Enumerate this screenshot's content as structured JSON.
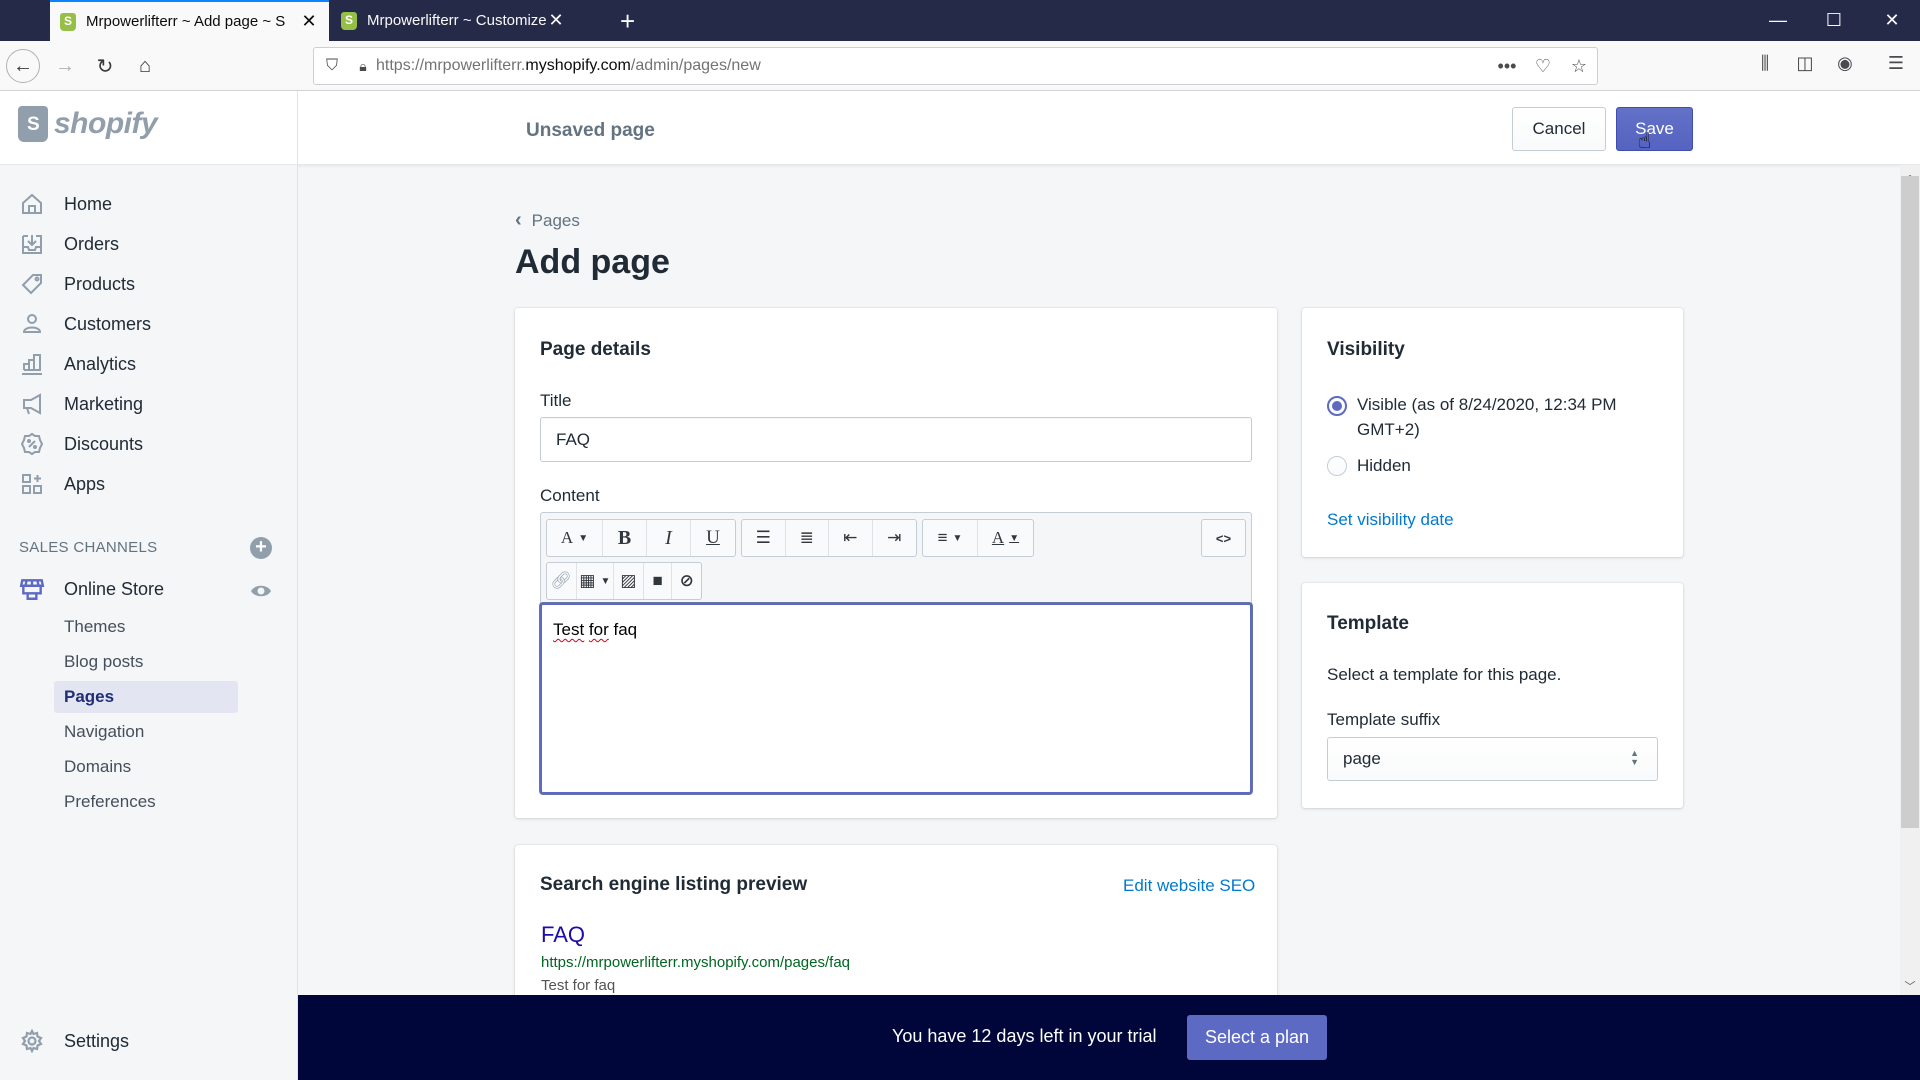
{
  "browser": {
    "tabs": [
      {
        "title": "Mrpowerlifterr ~ Add page ~ S",
        "active": true
      },
      {
        "title": "Mrpowerlifterr ~ Customize ~ I",
        "active": false
      }
    ],
    "new_tab": "+",
    "url_prefix": "https://mrpowerlifterr.",
    "url_domain": "myshopify.com",
    "url_path": "/admin/pages/new",
    "window_controls": {
      "minimize": "—",
      "maximize": "☐",
      "close": "✕"
    }
  },
  "topbar": {
    "logo": "shopify",
    "page_status": "Unsaved page",
    "cancel_label": "Cancel",
    "save_label": "Save"
  },
  "sidebar": {
    "items": [
      {
        "label": "Home",
        "icon": "home-icon"
      },
      {
        "label": "Orders",
        "icon": "orders-icon"
      },
      {
        "label": "Products",
        "icon": "tag-icon"
      },
      {
        "label": "Customers",
        "icon": "person-icon"
      },
      {
        "label": "Analytics",
        "icon": "bar-chart-icon"
      },
      {
        "label": "Marketing",
        "icon": "megaphone-icon"
      },
      {
        "label": "Discounts",
        "icon": "discount-icon"
      },
      {
        "label": "Apps",
        "icon": "apps-icon"
      }
    ],
    "sales_channels_heading": "SALES CHANNELS",
    "online_store": "Online Store",
    "sub_items": [
      {
        "label": "Themes",
        "active": false
      },
      {
        "label": "Blog posts",
        "active": false
      },
      {
        "label": "Pages",
        "active": true
      },
      {
        "label": "Navigation",
        "active": false
      },
      {
        "label": "Domains",
        "active": false
      },
      {
        "label": "Preferences",
        "active": false
      }
    ],
    "settings": "Settings"
  },
  "main": {
    "breadcrumb": "Pages",
    "title": "Add page",
    "page_details": {
      "heading": "Page details",
      "title_label": "Title",
      "title_value": "FAQ",
      "content_label": "Content",
      "content_value": "Test for faq",
      "content_words": [
        "Test",
        "for",
        "faq"
      ],
      "toolbar": {
        "font": "A",
        "bold": "B",
        "italic": "I",
        "underline": "U",
        "text_color": "A",
        "html": "<>"
      }
    },
    "visibility": {
      "heading": "Visibility",
      "visible_label": "Visible (as of 8/24/2020, 12:34 PM GMT+2)",
      "hidden_label": "Hidden",
      "selected": "visible",
      "set_date_link": "Set visibility date"
    },
    "template": {
      "heading": "Template",
      "description": "Select a template for this page.",
      "suffix_label": "Template suffix",
      "suffix_value": "page"
    },
    "seo": {
      "heading": "Search engine listing preview",
      "edit_link": "Edit website SEO",
      "preview_title": "FAQ",
      "preview_url": "https://mrpowerlifterr.myshopify.com/pages/faq",
      "preview_description": "Test for faq"
    }
  },
  "banner": {
    "text": "You have 12 days left in your trial",
    "button": "Select a plan"
  },
  "colors": {
    "primary": "#5c6ac4",
    "link": "#007ace",
    "banner_bg": "#000639"
  }
}
